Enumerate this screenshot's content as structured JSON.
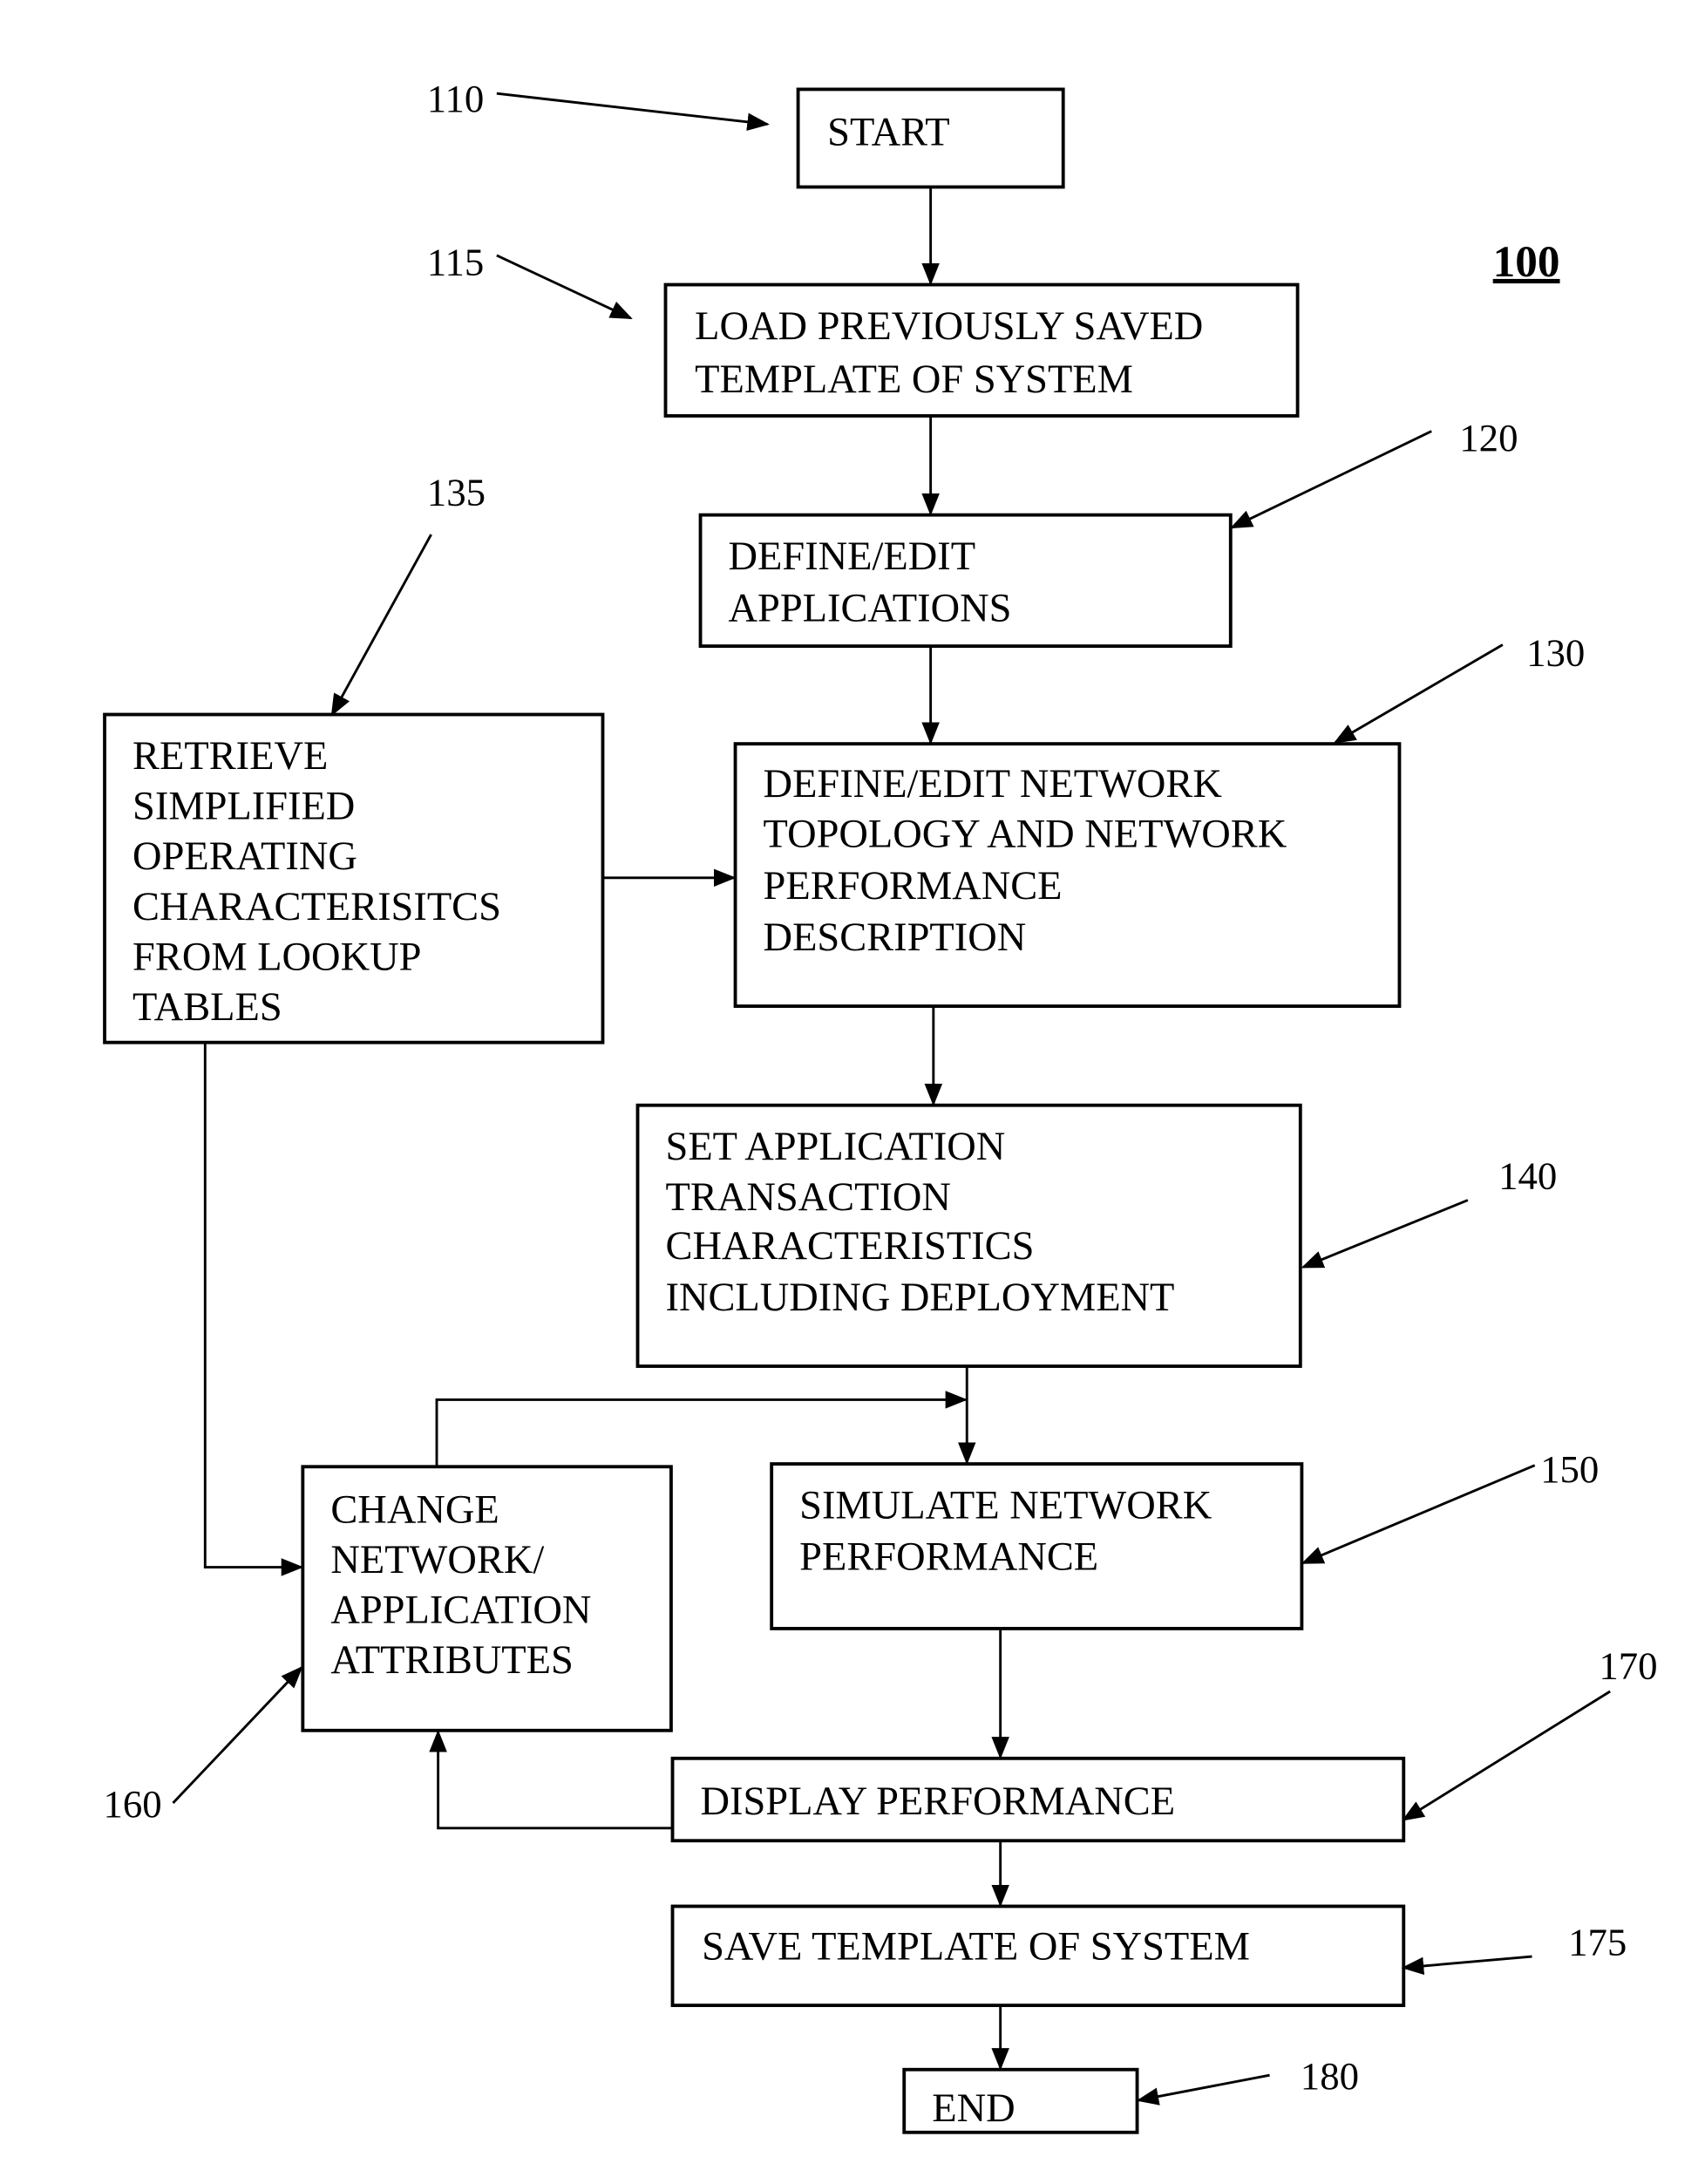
{
  "figure_label": "100",
  "steps": {
    "start": {
      "ref": "110",
      "lines": [
        "START"
      ]
    },
    "load": {
      "ref": "115",
      "lines": [
        "LOAD PREVIOUSLY SAVED",
        "TEMPLATE OF SYSTEM"
      ]
    },
    "define_apps": {
      "ref": "120",
      "lines": [
        "DEFINE/EDIT",
        "APPLICATIONS"
      ]
    },
    "define_net": {
      "ref": "130",
      "lines": [
        "DEFINE/EDIT NETWORK",
        "TOPOLOGY AND NETWORK",
        "PERFORMANCE",
        "DESCRIPTION"
      ]
    },
    "retrieve": {
      "ref": "135",
      "lines": [
        "RETRIEVE",
        "SIMPLIFIED",
        "OPERATING",
        "CHARACTERISITCS",
        "FROM LOOKUP",
        "TABLES"
      ]
    },
    "set_app": {
      "ref": "140",
      "lines": [
        "SET APPLICATION",
        "TRANSACTION",
        "CHARACTERISTICS",
        "INCLUDING DEPLOYMENT"
      ]
    },
    "simulate": {
      "ref": "150",
      "lines": [
        "SIMULATE NETWORK",
        "PERFORMANCE"
      ]
    },
    "change": {
      "ref": "160",
      "lines": [
        "CHANGE",
        "NETWORK/",
        "APPLICATION",
        "ATTRIBUTES"
      ]
    },
    "display": {
      "ref": "170",
      "lines": [
        "DISPLAY PERFORMANCE"
      ]
    },
    "save": {
      "ref": "175",
      "lines": [
        "SAVE TEMPLATE OF SYSTEM"
      ]
    },
    "end": {
      "ref": "180",
      "lines": [
        "END"
      ]
    }
  }
}
